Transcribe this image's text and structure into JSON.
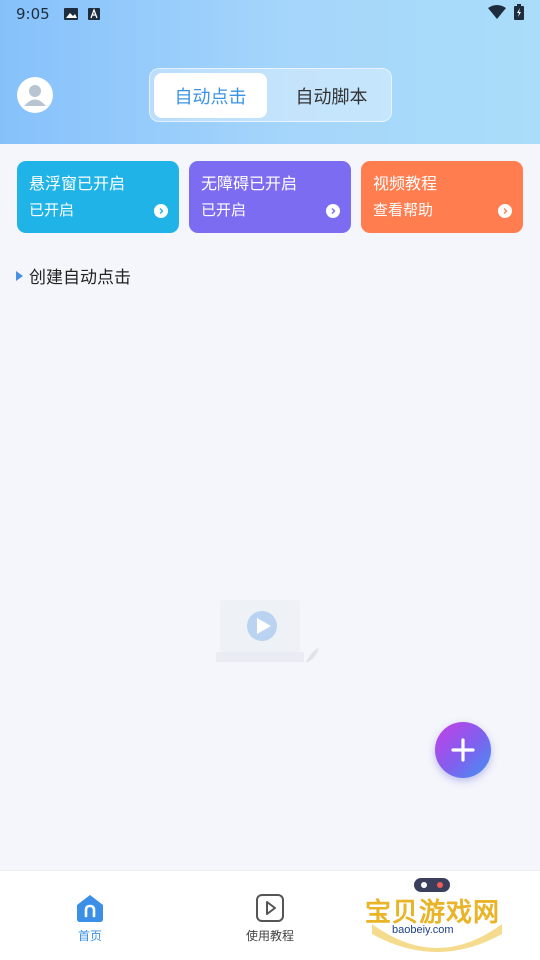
{
  "status_bar": {
    "time": "9:05"
  },
  "segmented": {
    "tab1": "自动点击",
    "tab2": "自动脚本"
  },
  "cards": [
    {
      "title": "悬浮窗已开启",
      "subtitle": "已开启",
      "color": "#20b3e8"
    },
    {
      "title": "无障碍已开启",
      "subtitle": "已开启",
      "color": "#7c6cf2"
    },
    {
      "title": "视频教程",
      "subtitle": "查看帮助",
      "color": "#ff7d4f"
    }
  ],
  "section": {
    "title": "创建自动点击"
  },
  "bottom_nav": {
    "home": "首页",
    "tutorial": "使用教程"
  },
  "watermark": {
    "name": "宝贝游戏网",
    "url": "baobeiy.com"
  },
  "icons": [
    "image-icon",
    "a-icon",
    "wifi-icon",
    "battery-icon",
    "avatar-icon",
    "chevron-right-icon",
    "play-icon",
    "plus-icon",
    "home-icon",
    "play-square-icon"
  ],
  "colors": {
    "accent": "#3b8fe6",
    "header_gradient_start": "#86c1fb",
    "header_gradient_end": "#a9ddf9"
  }
}
